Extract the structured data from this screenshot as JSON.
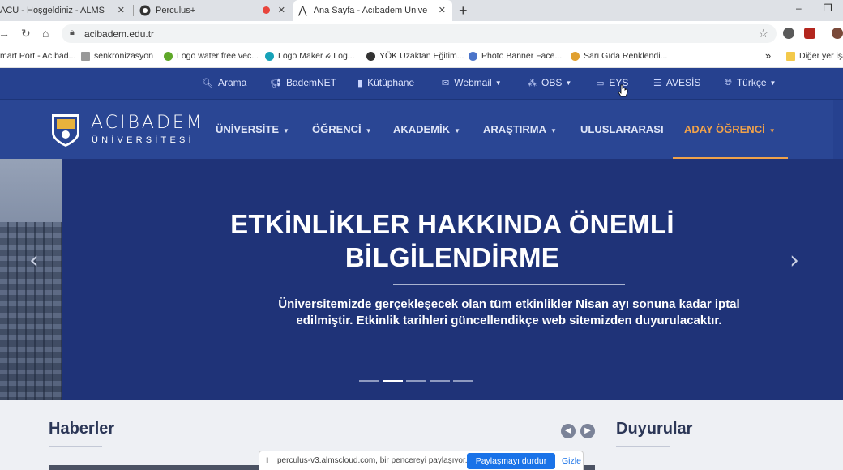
{
  "browser": {
    "tabs": [
      {
        "title": "ACU - Hoşgeldiniz - ALMS",
        "icon": "site-icon"
      },
      {
        "title": "Perculus+",
        "icon": "perculus-icon",
        "recording": true
      },
      {
        "title": "Ana Sayfa - Acıbadem Üniversite",
        "icon": "acibadem-icon",
        "active": true
      }
    ],
    "new_tab": "+",
    "url": "acibadem.edu.tr",
    "bookmarks": [
      {
        "label": "mart Port - Acıbad...",
        "color": "#777"
      },
      {
        "label": "senkronizasyon",
        "color": "#999"
      },
      {
        "label": "Logo water free vec...",
        "color": "#5fa829"
      },
      {
        "label": "Logo Maker & Log...",
        "color": "#444"
      },
      {
        "label": "YÖK Uzaktan Eğitim...",
        "color": "#333"
      },
      {
        "label": "Photo Banner Face...",
        "color": "#4b74c9"
      },
      {
        "label": "Sarı Gıda Renklendi...",
        "color": "#e0a030"
      }
    ],
    "bookmarks_more": "»",
    "other_bookmarks": "Diğer yer işa"
  },
  "site": {
    "topbar": [
      {
        "label": "Arama",
        "icon": "search-icon"
      },
      {
        "label": "BademNET",
        "icon": "megaphone-icon"
      },
      {
        "label": "Kütüphane",
        "icon": "book-icon"
      },
      {
        "label": "Webmail",
        "icon": "mail-icon",
        "dropdown": true
      },
      {
        "label": "OBS",
        "icon": "sitemap-icon",
        "dropdown": true
      },
      {
        "label": "EYS",
        "icon": "screen-icon"
      },
      {
        "label": "AVESİS",
        "icon": "list-icon"
      },
      {
        "label": "Türkçe",
        "icon": "globe-icon",
        "dropdown": true
      }
    ],
    "logo": {
      "line1": "ACIBADEM",
      "line2": "ÜNİVERSİTESİ"
    },
    "nav": [
      {
        "label": "ÜNİVERSİTE",
        "dropdown": true
      },
      {
        "label": "ÖĞRENCİ",
        "dropdown": true
      },
      {
        "label": "AKADEMİK",
        "dropdown": true
      },
      {
        "label": "ARAŞTIRMA",
        "dropdown": true
      },
      {
        "label": "ULUSLARARASI",
        "dropdown": false
      },
      {
        "label": "ADAY ÖĞRENCİ",
        "dropdown": true,
        "active": true
      }
    ],
    "hero": {
      "title_line1": "ETKİNLİKLER HAKKINDA ÖNEMLİ",
      "title_line2": "BİLGİLENDİRME",
      "description": "Üniversitemizde gerçekleşecek olan tüm etkinlikler Nisan ayı sonuna kadar iptal edilmiştir. Etkinlik tarihleri güncellendikçe web sitemizden duyurulacaktır.",
      "slides": 5,
      "active_slide": 2
    },
    "sections": {
      "news": "Haberler",
      "announcements": "Duyurular"
    }
  },
  "share_bar": {
    "message": "perculus-v3.almscloud.com, bir pencereyi paylaşıyor.",
    "stop_label": "Paylaşmayı durdur",
    "hide_label": "Gizle"
  },
  "colors": {
    "navy": "#26418f",
    "accent": "#f0a24a",
    "hero": "#1f3378"
  }
}
